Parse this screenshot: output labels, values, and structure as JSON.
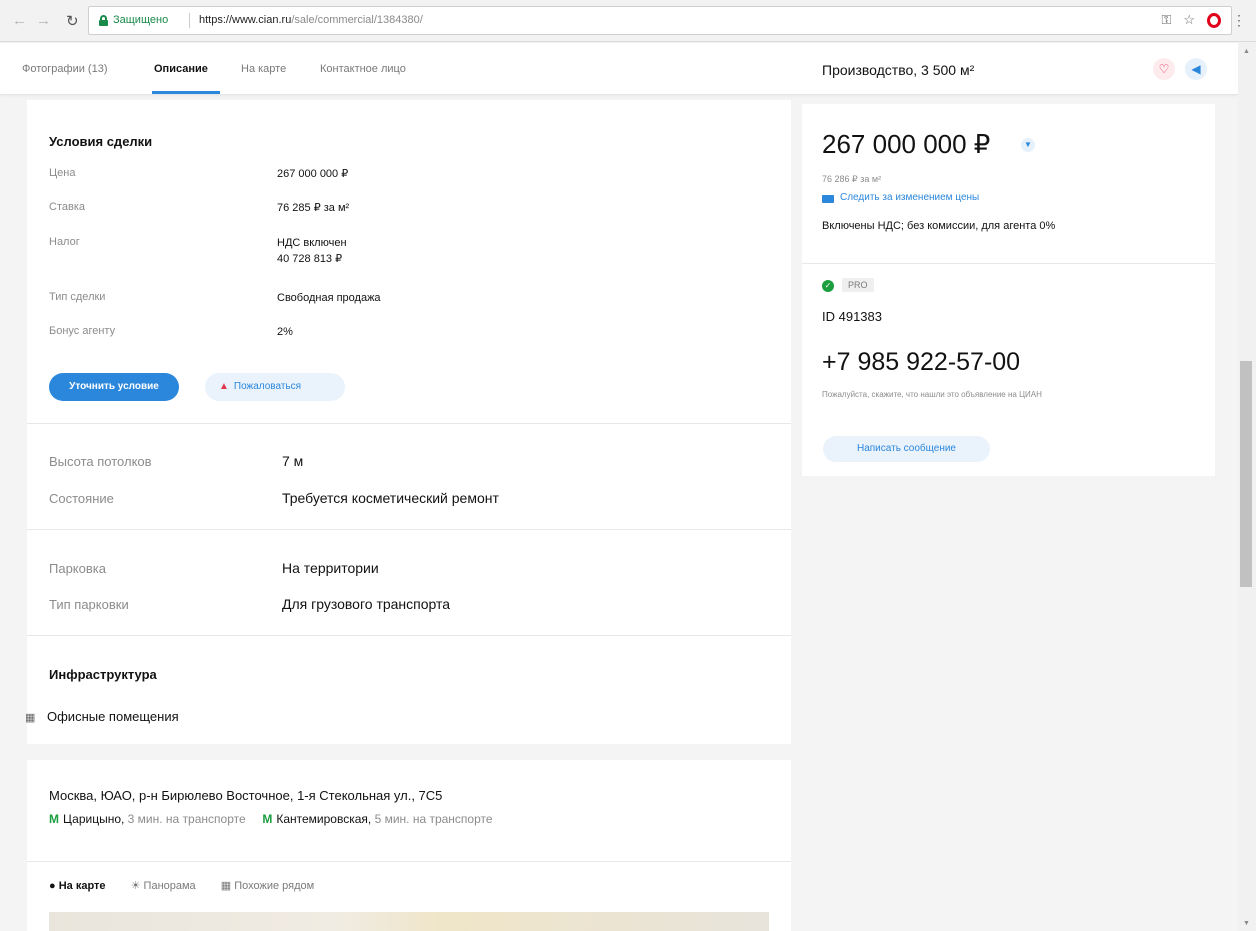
{
  "browser": {
    "secure_label": "Защищено",
    "url_host": "https://www.cian.ru",
    "url_path": "/sale/commercial/1384380/",
    "key_icon": "key-icon",
    "star_icon": "star-icon"
  },
  "tabs": [
    {
      "label": "Фотографии (13)"
    },
    {
      "label": "Описание"
    },
    {
      "label": "На карте"
    },
    {
      "label": "Контактное лицо"
    }
  ],
  "header": {
    "title": "Производство, 3 500 м²"
  },
  "deal": {
    "title": "Условия сделки",
    "rows": [
      {
        "label": "Цена",
        "value": "267 000 000 ₽"
      },
      {
        "label": "Ставка",
        "value": "76 285 ₽ за м²"
      },
      {
        "label": "Налог",
        "value": "НДС включен",
        "value2": "40 728 813 ₽"
      },
      {
        "label": "Тип сделки",
        "value": "Свободная продажа"
      },
      {
        "label": "Бонус агенту",
        "value": "2%"
      }
    ],
    "clarify_button": "Уточнить условие",
    "complain_button": "Пожаловаться"
  },
  "building": {
    "rows": [
      {
        "label": "Высота потолков",
        "value": "7 м"
      },
      {
        "label": "Состояние",
        "value": "Требуется косметический ремонт"
      }
    ]
  },
  "parking": {
    "rows": [
      {
        "label": "Парковка",
        "value": "На территории"
      },
      {
        "label": "Тип парковки",
        "value": "Для грузового транспорта"
      }
    ]
  },
  "infrastructure": {
    "title": "Инфраструктура",
    "items": [
      {
        "label": "Офисные помещения"
      }
    ]
  },
  "location": {
    "address": "Москва, ЮАО, р-н Бирюлево Восточное, 1-я Стекольная ул., 7С5",
    "metro": [
      {
        "name": "Царицыно",
        "time": "3 мин. на транспорте"
      },
      {
        "name": "Кантемировская",
        "time": "5 мин. на транспорте"
      }
    ],
    "map_tabs": [
      {
        "label": "На карте"
      },
      {
        "label": "Панорама"
      },
      {
        "label": "Похожие рядом"
      }
    ]
  },
  "price_card": {
    "price": "267 000 000 ₽",
    "price_per_m2": "76 286 ₽ за м²",
    "follow_link": "Следить за изменением цены",
    "vat_note": "Включены НДС; без комиссии, для агента 0%",
    "pro_badge": "PRO",
    "agent_id": "ID 491383",
    "phone": "+7 985 922-57-00",
    "phone_note": "Пожалуйста, скажите, что нашли это объявление на ЦИАН",
    "message_button": "Написать сообщение"
  },
  "colors": {
    "accent": "#2b87db",
    "metro": "#1b9e3e",
    "favorite": "#e0354e"
  }
}
